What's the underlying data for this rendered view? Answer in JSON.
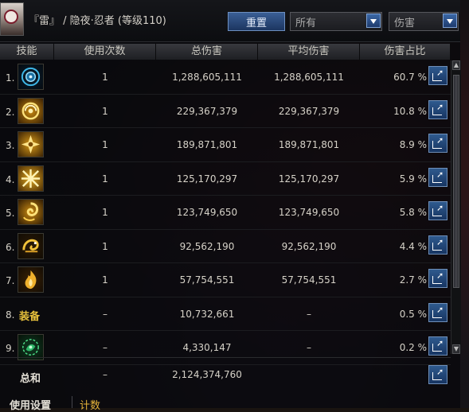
{
  "header": {
    "title": "『雷』 / 隐夜·忍者 (等级110)",
    "reset_label": "重置",
    "filter_select": "所有",
    "metric_select": "伤害"
  },
  "columns": [
    "技能",
    "使用次数",
    "总伤害",
    "平均伤害",
    "伤害占比"
  ],
  "rows": [
    {
      "index": "1.",
      "icon": "blue-orb-skill-icon",
      "count": "1",
      "total": "1,288,605,111",
      "average": "1,288,605,111",
      "percent": "60.7 %"
    },
    {
      "index": "2.",
      "icon": "golden-vortex-skill-icon",
      "count": "1",
      "total": "229,367,379",
      "average": "229,367,379",
      "percent": "10.8 %"
    },
    {
      "index": "3.",
      "icon": "golden-shuriken-skill-icon",
      "count": "1",
      "total": "189,871,801",
      "average": "189,871,801",
      "percent": "8.9 %"
    },
    {
      "index": "4.",
      "icon": "cross-slash-skill-icon",
      "count": "1",
      "total": "125,170,297",
      "average": "125,170,297",
      "percent": "5.9 %"
    },
    {
      "index": "5.",
      "icon": "spiral-flame-skill-icon",
      "count": "1",
      "total": "123,749,650",
      "average": "123,749,650",
      "percent": "5.8 %"
    },
    {
      "index": "6.",
      "icon": "golden-dragon-skill-icon",
      "count": "1",
      "total": "92,562,190",
      "average": "92,562,190",
      "percent": "4.4 %"
    },
    {
      "index": "7.",
      "icon": "golden-flame-skill-icon",
      "count": "1",
      "total": "57,754,551",
      "average": "57,754,551",
      "percent": "2.7 %"
    },
    {
      "index": "8.",
      "label": "装备",
      "count": "–",
      "total": "10,732,661",
      "average": "–",
      "percent": "0.5 %"
    },
    {
      "index": "9.",
      "icon": "green-spirit-skill-icon",
      "count": "–",
      "total": "4,330,147",
      "average": "–",
      "percent": "0.2 %"
    }
  ],
  "total_row": {
    "label": "总和",
    "count": "–",
    "total": "2,124,374,760"
  },
  "bottom_tabs": {
    "settings": "使用设置",
    "stats": "计数"
  },
  "colors": {
    "accent_blue": "#2f5a8e",
    "gold": "#e8c23c",
    "text": "#d6d2c8"
  }
}
